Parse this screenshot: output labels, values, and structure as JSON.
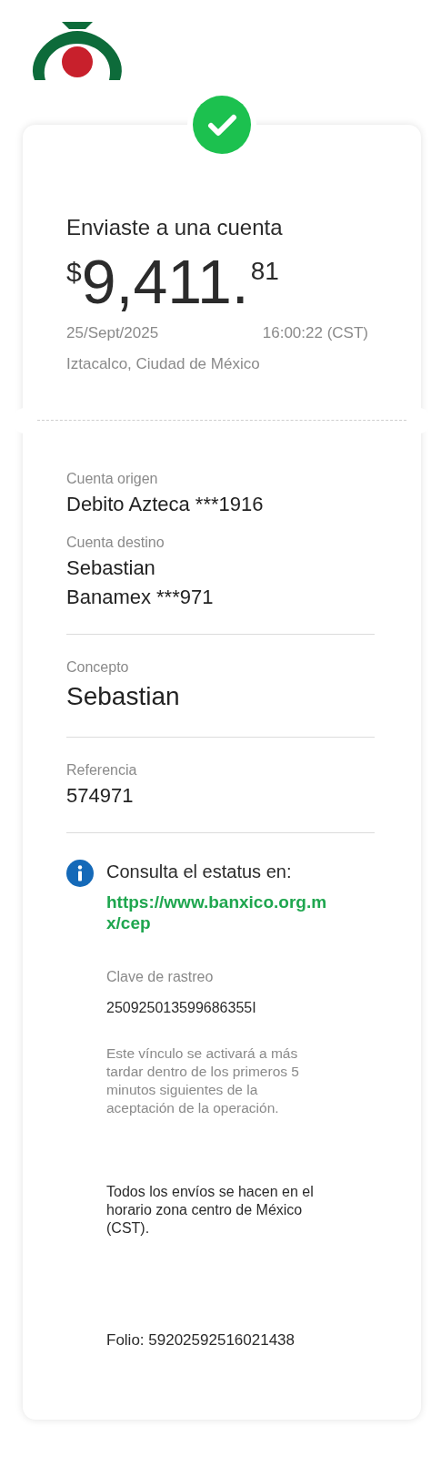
{
  "header": {
    "title": "Enviaste a una cuenta",
    "amount": {
      "currency": "$",
      "whole": "9,411.",
      "cents": "81"
    },
    "date": "25/Sept/2025",
    "time": "16:00:22 (CST)",
    "location": "Iztacalco, Ciudad de México"
  },
  "sections": [
    {
      "fields": [
        {
          "label": "Cuenta origen",
          "lines": [
            "Debito Azteca ***1916"
          ],
          "kind": "normal"
        },
        {
          "label": "Cuenta destino",
          "lines": [
            "Sebastian",
            "Banamex ***971"
          ],
          "kind": "normal"
        }
      ]
    },
    {
      "fields": [
        {
          "label": "Concepto",
          "lines": [
            "Sebastian"
          ],
          "kind": "large"
        }
      ]
    },
    {
      "fields": [
        {
          "label": "Referencia",
          "lines": [
            "574971"
          ],
          "kind": "normal"
        }
      ]
    }
  ],
  "info": {
    "title": "Consulta el estatus en:",
    "link": "https://www.banxico.org.mx/cep",
    "tracking_label": "Clave de rastreo",
    "tracking_value": "250925013599686355I",
    "note": "Este vínculo se activará a más tardar dentro de los primeros 5 minutos siguientes de la aceptación de la operación.",
    "timezone_note": "Todos los envíos se hacen en el horario zona centro de México (CST).",
    "folio": "Folio: 59202592516021438"
  }
}
